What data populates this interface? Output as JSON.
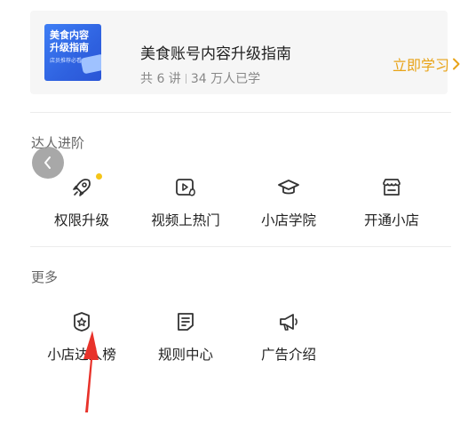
{
  "course": {
    "thumb_line1": "美食内容",
    "thumb_line2": "升级指南",
    "thumb_sub": "店员推荐必看",
    "title": "美食账号内容升级指南",
    "lessons": "共 6 讲",
    "learners": "34 万人已学",
    "cta": "立即学习"
  },
  "section_expert": {
    "title": "达人进阶",
    "items": [
      {
        "label": "权限升级",
        "icon": "rocket-icon"
      },
      {
        "label": "视频上热门",
        "icon": "video-fire-icon"
      },
      {
        "label": "小店学院",
        "icon": "graduation-cap-icon"
      },
      {
        "label": "开通小店",
        "icon": "storefront-icon"
      }
    ]
  },
  "section_more": {
    "title": "更多",
    "items": [
      {
        "label": "小店达人榜",
        "icon": "badge-star-icon"
      },
      {
        "label": "规则中心",
        "icon": "document-rules-icon"
      },
      {
        "label": "广告介绍",
        "icon": "megaphone-icon"
      }
    ]
  },
  "colors": {
    "accent": "#e8a317",
    "badge_dot": "#f5c518",
    "annotation_arrow": "#e8322a",
    "thumb_blue": "#3e7ef5"
  }
}
